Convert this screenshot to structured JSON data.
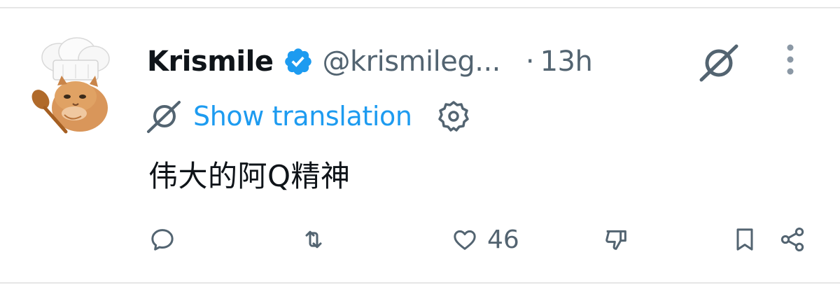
{
  "author": {
    "display_name": "Krismile",
    "handle": "@krismileg...",
    "separator": "·",
    "time": "13h"
  },
  "translation": {
    "link_label": "Show translation"
  },
  "tweet": {
    "text": "伟大的阿Q精神"
  },
  "actions": {
    "like_count": "46"
  },
  "colors": {
    "accent": "#1d9bf0",
    "muted": "#536471",
    "text": "#0f1419"
  },
  "icons": [
    "avatar",
    "verified-badge-icon",
    "grok-icon",
    "more-icon",
    "translate-icon",
    "settings-icon",
    "reply-icon",
    "retweet-icon",
    "like-icon",
    "dislike-icon",
    "bookmark-icon",
    "share-icon"
  ]
}
